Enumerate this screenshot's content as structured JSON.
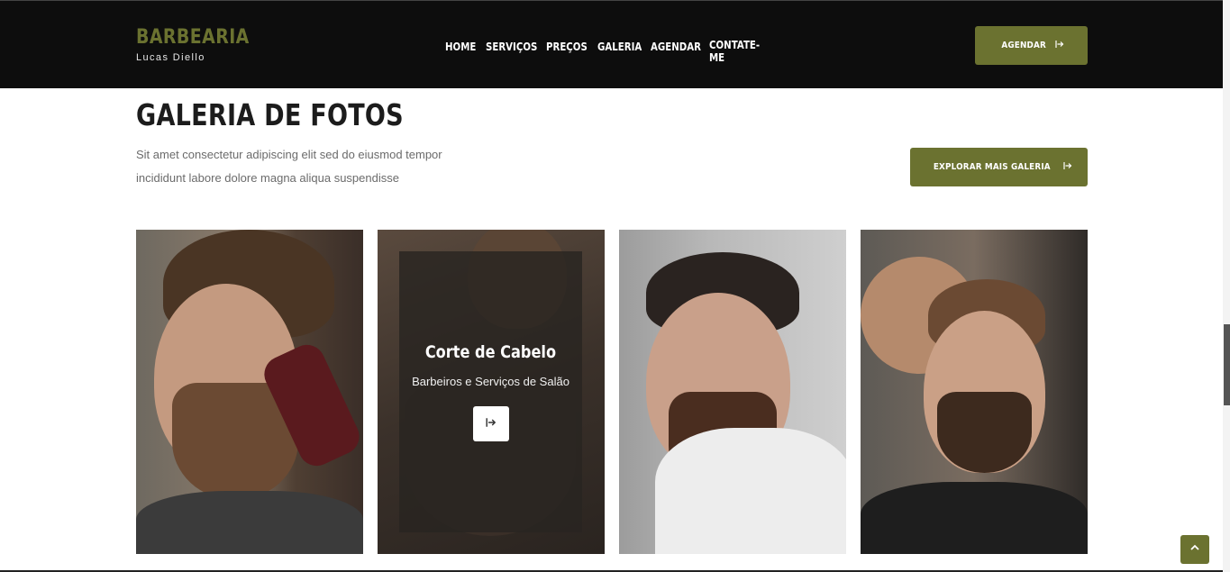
{
  "header": {
    "brand_title": "BARBEARIA",
    "brand_subtitle": "Lucas Diello",
    "nav": [
      "HOME",
      "SERVIÇOS",
      "PREÇOS",
      "GALERIA",
      "AGENDAR",
      "CONTATE-ME"
    ],
    "cta_label": "AGENDAR",
    "cta_icon": "arrow-right-icon"
  },
  "gallery": {
    "title": "GALERIA DE FOTOS",
    "description": "Sit amet consectetur adipiscing elit sed do eiusmod tempor incididunt labore dolore magna aliqua suspendisse",
    "explore_label": "EXPLORAR MAIS GALERIA",
    "overlay": {
      "title": "Corte de Cabelo",
      "subtitle": "Barbeiros e Serviços de Salão",
      "button_icon": "arrow-right-icon"
    }
  },
  "colors": {
    "accent": "#6b7230",
    "header_bg": "#0d0d0d",
    "heading": "#1c1c1c",
    "body_text": "#6b6b6b"
  }
}
